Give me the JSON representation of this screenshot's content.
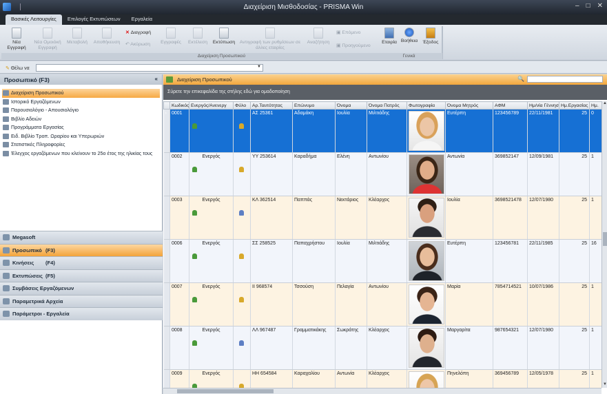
{
  "window": {
    "title": "Διαχείριση Μισθοδοσίας - PRISMA Win"
  },
  "menu_tabs": [
    "Βασικές Λειτουργίες",
    "Επιλογές Εκτυπώσεων",
    "Εργαλεία"
  ],
  "ribbon": {
    "group1_label": "Διαχείριση Προσωπικού",
    "group2_label": "Γενικά",
    "new": "Νέα Εγγραφή",
    "new_similar": "Νέα Ομοιόκή Εγγραφή",
    "edit": "Μεταβολή",
    "save": "Αποθήκευση",
    "delete": "Διαγραφή",
    "cancel": "Ακύρωση",
    "records": "Εγγραφές",
    "execute": "Εκτέλεση",
    "print": "Εκτύπωση",
    "copy_settings": "Αντιγραφή των ρυθμίσεων σε άλλες εταιρίες",
    "search": "Αναζήτηση",
    "next": "Επόμενο",
    "previous": "Προηγούμενο",
    "company": "Εταιρία",
    "help": "Βοήθεια",
    "exit": "Έξοδος"
  },
  "searchbar": {
    "label": "Θέλω να",
    "value": ""
  },
  "left_pane": {
    "title": "Προσωπικό    (F3)",
    "items": [
      "Διαχείριση Προσωπικού",
      "Ιστορικό Εργαζόμενων",
      "Παρουσιολόγιο - Απουσιολόγιο",
      "Βιβλίο Αδειών",
      "Προγράμματα Εργασίας",
      "Ειδ. Βιβλίο Τροπ. Ωραρίου και Υπερωριών",
      "Στατιστικές Πληροφορίες",
      "Έλεγχος εργαζόμενων που κλείνουν το 25ο έτος της ηλικίας τους"
    ],
    "nav_panes": [
      {
        "label": "Megasoft",
        "key": ""
      },
      {
        "label": "Προσωπικό",
        "key": "(F3)"
      },
      {
        "label": "Κινήσεις",
        "key": "(F4)"
      },
      {
        "label": "Εκτυπώσεις",
        "key": "(F5)"
      },
      {
        "label": "Συμβάσεις Εργαζόμενων",
        "key": ""
      },
      {
        "label": "Παραμετρικά Αρχεία",
        "key": ""
      },
      {
        "label": "Παράμετροι - Εργαλεία",
        "key": ""
      }
    ]
  },
  "main": {
    "title": "Διαχείριση Προσωπικού",
    "group_hint": "Σύρετε την επικεφαλίδα της στήλης εδώ για ομαδοποίηση",
    "columns": [
      "Κωδικός",
      "Ενεργός/Ανενεργ",
      "Φύλο",
      "Αρ.Ταυτότητας",
      "Επώνυμο",
      "Όνομα",
      "Όνομα Πατρός",
      "Φωτογραφία",
      "Όνομα Μητρός",
      "ΑΦΜ",
      "Ημ/νία Γέννησης",
      "Ημ.Εργασίας",
      "Ημ."
    ],
    "rows": [
      {
        "code": "0001",
        "active": "",
        "gender": "female",
        "id": "ΑΣ 25361",
        "surname": "Αδαμάκη",
        "name": "Ιουλία",
        "father": "Μιλτιάδης",
        "mother": "Ευτέρπη",
        "afm": "123456789",
        "birth": "22/11/1981",
        "work": "25",
        "extra": "0"
      },
      {
        "code": "0002",
        "active": "Ενεργός",
        "gender": "female",
        "id": "ΥΥ 253614",
        "surname": "Καραδήμα",
        "name": "Ελένη",
        "father": "Αντωνίου",
        "mother": "Αντωνία",
        "afm": "369852147",
        "birth": "12/09/1981",
        "work": "25",
        "extra": "1"
      },
      {
        "code": "0003",
        "active": "Ενεργός",
        "gender": "male",
        "id": "ΚΛ 362514",
        "surname": "Παππάς",
        "name": "Νεκτάριος",
        "father": "Κλέαρχος",
        "mother": "Ιουλία",
        "afm": "3698521478",
        "birth": "12/07/1980",
        "work": "25",
        "extra": "1"
      },
      {
        "code": "0006",
        "active": "Ενεργός",
        "gender": "female",
        "id": "ΣΣ 258525",
        "surname": "Παπαχρήστου",
        "name": "Ιουλία",
        "father": "Μιλτιάδης",
        "mother": "Ευτέρπη",
        "afm": "123456781",
        "birth": "22/11/1985",
        "work": "25",
        "extra": "16"
      },
      {
        "code": "0007",
        "active": "Ενεργός",
        "gender": "female",
        "id": "ΙΙ 968574",
        "surname": "Τσσούση",
        "name": "Πελαγία",
        "father": "Αντωνίου",
        "mother": "Μαρία",
        "afm": "7854714521",
        "birth": "10/07/1986",
        "work": "25",
        "extra": "1"
      },
      {
        "code": "0008",
        "active": "Ενεργός",
        "gender": "male",
        "id": "ΛΛ 967487",
        "surname": "Γραμματικάκης",
        "name": "Σωκράτης",
        "father": "Κλέαρχος",
        "mother": "Μαργαρίτα",
        "afm": "987654321",
        "birth": "12/07/1980",
        "work": "25",
        "extra": "1"
      },
      {
        "code": "0009",
        "active": "Ενεργός",
        "gender": "female",
        "id": "ΗΗ 654584",
        "surname": "Καραχαλίου",
        "name": "Αντωνία",
        "father": "Κλέαρχος",
        "mother": "Πηνελόπη",
        "afm": "369456789",
        "birth": "12/05/1978",
        "work": "25",
        "extra": "1"
      }
    ]
  }
}
